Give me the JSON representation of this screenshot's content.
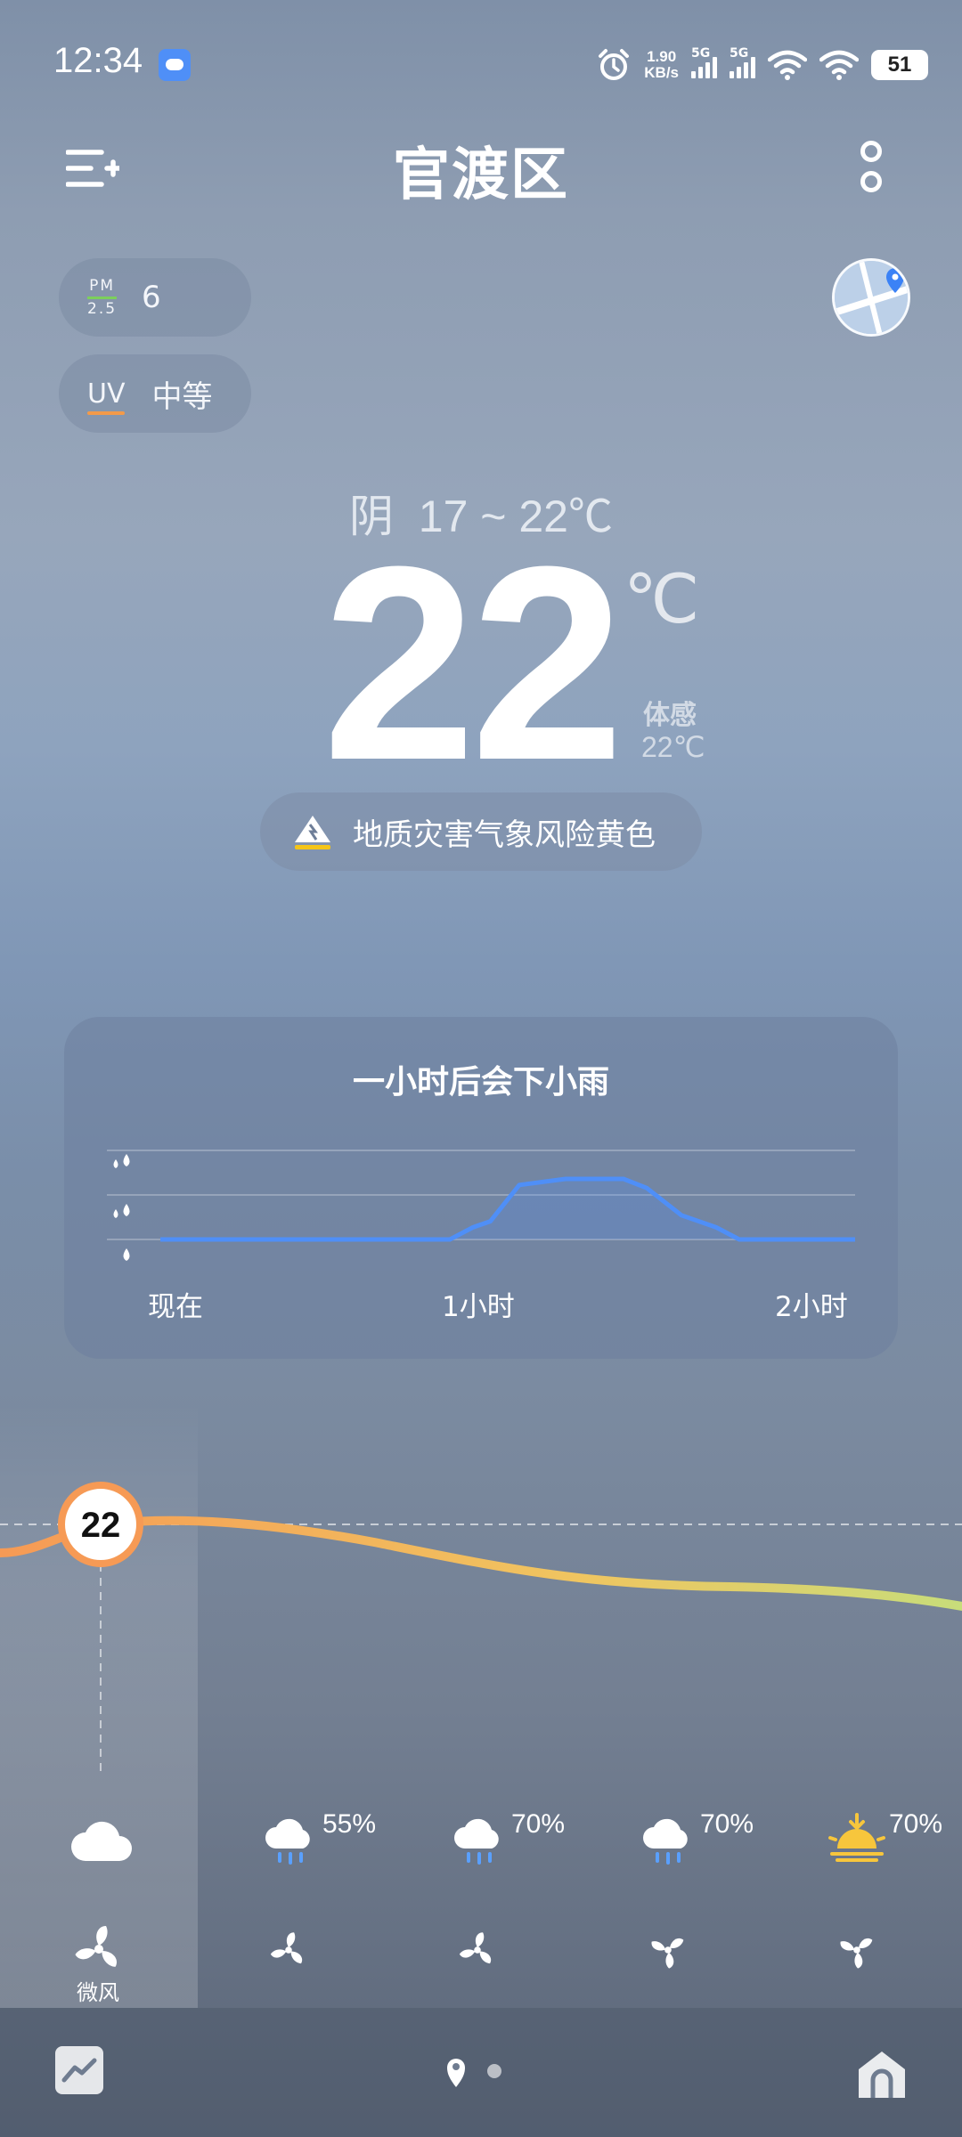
{
  "status_bar": {
    "time": "12:34",
    "net_speed_value": "1.90",
    "net_speed_unit": "KB/s",
    "signal_1_label": "5G",
    "signal_2_label": "5G",
    "battery": "51"
  },
  "header": {
    "city": "官渡区",
    "menu_icon": "menu-add-icon",
    "more_icon": "more-vertical-icon"
  },
  "air": {
    "pm_label_top": "PM",
    "pm_label_bottom": "2.5",
    "pm_value": "6",
    "uv_label": "UV",
    "uv_value": "中等",
    "pm_bar_color": "#7ccf5c",
    "uv_bar_color": "#f39a4a"
  },
  "current": {
    "condition": "阴",
    "range": "17 ~ 22℃",
    "temp": "22",
    "unit": "℃",
    "feels_label": "体感",
    "feels_value": "22℃"
  },
  "alert": {
    "text": "地质灾害气象风险黄色",
    "color": "#f5c518"
  },
  "rain_card": {
    "title": "一小时后会下小雨",
    "x_labels": [
      "现在",
      "1小时",
      "2小时"
    ],
    "line_color": "#4f8ff7"
  },
  "chart_data": {
    "type": "area",
    "title": "一小时后会下小雨",
    "x_labels": [
      "现在",
      "1小时",
      "2小时"
    ],
    "x_minutes": [
      0,
      40,
      50,
      54,
      57,
      62,
      70,
      80,
      84,
      90,
      96,
      100,
      120
    ],
    "intensity": [
      0,
      0,
      0,
      0.2,
      0.3,
      0.9,
      1.0,
      1.0,
      0.85,
      0.4,
      0.2,
      0,
      0
    ],
    "ylim": [
      0,
      3
    ],
    "y_levels": [
      "light",
      "moderate",
      "heavy"
    ]
  },
  "hourly": {
    "current_temp": "22",
    "items": [
      {
        "icon": "cloudy-icon",
        "precip": "",
        "wind_icon": "wind-fan-icon",
        "wind": "微风"
      },
      {
        "icon": "rain-cloud-icon",
        "precip": "55%",
        "wind_icon": "wind-fan-icon",
        "wind": ""
      },
      {
        "icon": "rain-cloud-icon",
        "precip": "70%",
        "wind_icon": "wind-fan-icon",
        "wind": ""
      },
      {
        "icon": "rain-cloud-icon",
        "precip": "70%",
        "wind_icon": "wind-fan-icon",
        "wind": ""
      },
      {
        "icon": "sunset-icon",
        "precip": "70%",
        "wind_icon": "wind-fan-icon",
        "wind": ""
      }
    ]
  },
  "bottom_nav": {
    "trend_icon": "trend-chart-icon",
    "location_icon": "location-pin-icon",
    "home_icon": "home-icon"
  }
}
